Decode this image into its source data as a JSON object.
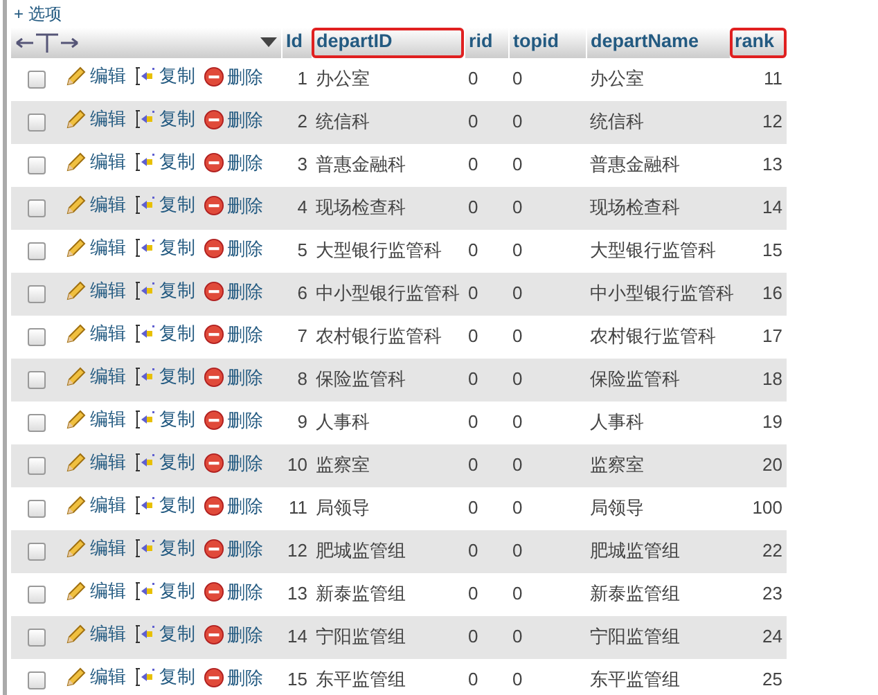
{
  "options_link": "+ 选项",
  "columns": [
    {
      "label": "Id",
      "highlighted": false
    },
    {
      "label": "departID",
      "highlighted": true
    },
    {
      "label": "rid",
      "highlighted": false
    },
    {
      "label": "topid",
      "highlighted": false
    },
    {
      "label": "departName",
      "highlighted": false
    },
    {
      "label": "rank",
      "highlighted": true
    }
  ],
  "rows": [
    {
      "checked": false,
      "actions": [
        "编辑",
        "复制",
        "删除"
      ],
      "cells": [
        "1",
        "办公室",
        "0",
        "0",
        "办公室",
        "11"
      ]
    },
    {
      "checked": false,
      "actions": [
        "编辑",
        "复制",
        "删除"
      ],
      "cells": [
        "2",
        "统信科",
        "0",
        "0",
        "统信科",
        "12"
      ]
    },
    {
      "checked": false,
      "actions": [
        "编辑",
        "复制",
        "删除"
      ],
      "cells": [
        "3",
        "普惠金融科",
        "0",
        "0",
        "普惠金融科",
        "13"
      ]
    },
    {
      "checked": false,
      "actions": [
        "编辑",
        "复制",
        "删除"
      ],
      "cells": [
        "4",
        "现场检查科",
        "0",
        "0",
        "现场检查科",
        "14"
      ]
    },
    {
      "checked": false,
      "actions": [
        "编辑",
        "复制",
        "删除"
      ],
      "cells": [
        "5",
        "大型银行监管科",
        "0",
        "0",
        "大型银行监管科",
        "15"
      ]
    },
    {
      "checked": false,
      "actions": [
        "编辑",
        "复制",
        "删除"
      ],
      "cells": [
        "6",
        "中小型银行监管科",
        "0",
        "0",
        "中小型银行监管科",
        "16"
      ]
    },
    {
      "checked": false,
      "actions": [
        "编辑",
        "复制",
        "删除"
      ],
      "cells": [
        "7",
        "农村银行监管科",
        "0",
        "0",
        "农村银行监管科",
        "17"
      ]
    },
    {
      "checked": false,
      "actions": [
        "编辑",
        "复制",
        "删除"
      ],
      "cells": [
        "8",
        "保险监管科",
        "0",
        "0",
        "保险监管科",
        "18"
      ]
    },
    {
      "checked": false,
      "actions": [
        "编辑",
        "复制",
        "删除"
      ],
      "cells": [
        "9",
        "人事科",
        "0",
        "0",
        "人事科",
        "19"
      ]
    },
    {
      "checked": false,
      "actions": [
        "编辑",
        "复制",
        "删除"
      ],
      "cells": [
        "10",
        "监察室",
        "0",
        "0",
        "监察室",
        "20"
      ]
    },
    {
      "checked": false,
      "actions": [
        "编辑",
        "复制",
        "删除"
      ],
      "cells": [
        "11",
        "局领导",
        "0",
        "0",
        "局领导",
        "100"
      ]
    },
    {
      "checked": false,
      "actions": [
        "编辑",
        "复制",
        "删除"
      ],
      "cells": [
        "12",
        "肥城监管组",
        "0",
        "0",
        "肥城监管组",
        "22"
      ]
    },
    {
      "checked": false,
      "actions": [
        "编辑",
        "复制",
        "删除"
      ],
      "cells": [
        "13",
        "新泰监管组",
        "0",
        "0",
        "新泰监管组",
        "23"
      ]
    },
    {
      "checked": false,
      "actions": [
        "编辑",
        "复制",
        "删除"
      ],
      "cells": [
        "14",
        "宁阳监管组",
        "0",
        "0",
        "宁阳监管组",
        "24"
      ]
    },
    {
      "checked": false,
      "actions": [
        "编辑",
        "复制",
        "删除"
      ],
      "cells": [
        "15",
        "东平监管组",
        "0",
        "0",
        "东平监管组",
        "25"
      ]
    }
  ]
}
